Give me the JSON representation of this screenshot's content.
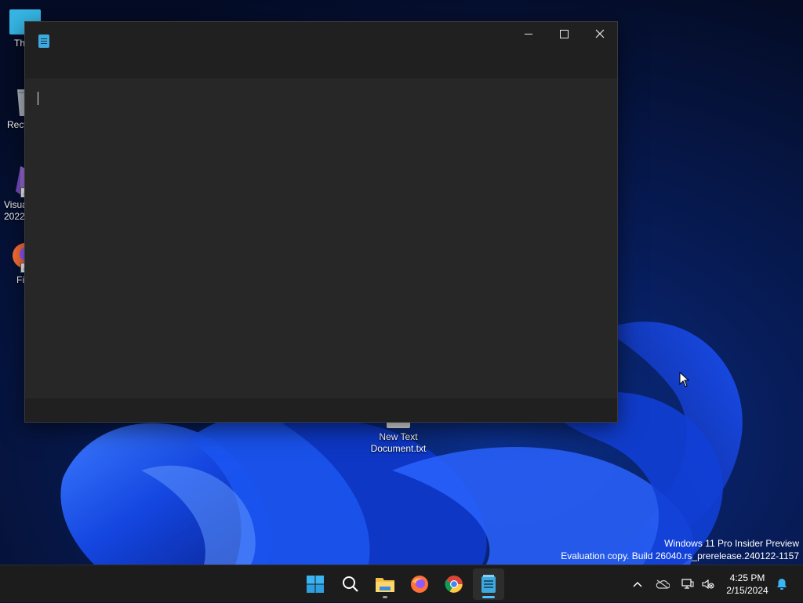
{
  "desktop": {
    "icons": [
      {
        "label": "Th",
        "icon": "this-pc-icon"
      },
      {
        "label": "Recy",
        "icon": "recycle-bin-icon"
      },
      {
        "label": "Visua\n2022",
        "icon": "visual-studio-icon"
      },
      {
        "label": "Fi",
        "icon": "firefox-icon"
      }
    ],
    "file": {
      "label": "New Text\nDocument.txt",
      "icon": "text-file-icon"
    }
  },
  "window": {
    "app": "Notepad",
    "app_icon": "notepad-icon",
    "controls": {
      "minimize": "minimize-icon",
      "maximize": "maximize-icon",
      "close": "close-icon"
    },
    "editor_text": ""
  },
  "watermark": {
    "line1": "Windows 11 Pro Insider Preview",
    "line2": "Evaluation copy. Build 26040.rs_prerelease.240122-1157"
  },
  "taskbar": {
    "apps": [
      {
        "name": "Start",
        "icon": "windows-start-icon"
      },
      {
        "name": "Search",
        "icon": "search-icon"
      },
      {
        "name": "File Explorer",
        "icon": "folder-icon"
      },
      {
        "name": "Firefox",
        "icon": "firefox-icon"
      },
      {
        "name": "Chrome",
        "icon": "chrome-icon"
      },
      {
        "name": "Notepad",
        "icon": "notepad-icon"
      }
    ],
    "tray": {
      "icons": [
        "chevron-up-icon",
        "onedrive-offline-icon",
        "network-icon",
        "volume-muted-icon",
        "notification-bell-icon"
      ],
      "time": "4:25 PM",
      "date": "2/15/2024"
    }
  },
  "colors": {
    "accent": "#4cc2ff",
    "window_bg": "#202020",
    "editor_bg": "#272727",
    "taskbar_bg": "#1c1c1c"
  }
}
